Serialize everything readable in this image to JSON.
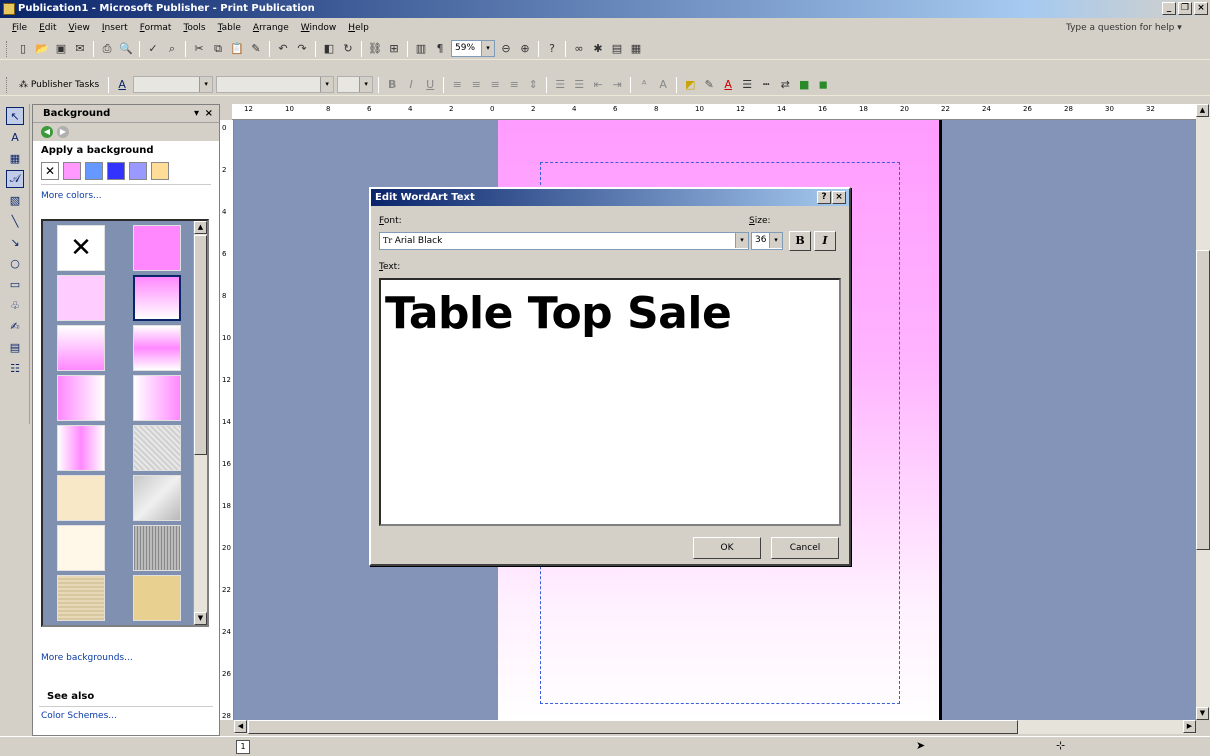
{
  "window": {
    "title": "Publication1 - Microsoft Publisher - Print Publication"
  },
  "menu": [
    "File",
    "Edit",
    "View",
    "Insert",
    "Format",
    "Tools",
    "Table",
    "Arrange",
    "Window",
    "Help"
  ],
  "help_box": "Type a question for help",
  "toolbar": {
    "zoom": "59%",
    "publisher_tasks": "Publisher Tasks"
  },
  "taskpane": {
    "title": "Background",
    "apply_label": "Apply a background",
    "more_colors": "More colors...",
    "more_backgrounds": "More backgrounds...",
    "see_also": "See also",
    "color_schemes": "Color Schemes...",
    "swatches": [
      "#ff99ff",
      "#6699ff",
      "#3333ff",
      "#9999ff",
      "#ffdd99"
    ]
  },
  "ruler": {
    "h_ticks": [
      "12",
      "10",
      "8",
      "6",
      "4",
      "2",
      "0",
      "2",
      "4",
      "6",
      "8",
      "10",
      "12",
      "14",
      "16",
      "18",
      "20",
      "22",
      "24",
      "26",
      "28",
      "30",
      "32"
    ],
    "v_ticks": [
      "0",
      "2",
      "4",
      "6",
      "8",
      "10",
      "12",
      "14",
      "16",
      "18",
      "20",
      "22",
      "24",
      "26",
      "28"
    ]
  },
  "dialog": {
    "title": "Edit WordArt Text",
    "font_label": "Font:",
    "font_value": "Arial Black",
    "size_label": "Size:",
    "size_value": "36",
    "bold": "B",
    "italic": "I",
    "text_label": "Text:",
    "text_value": "Table Top Sale",
    "ok": "OK",
    "cancel": "Cancel"
  },
  "status": {
    "page_number": "1"
  }
}
